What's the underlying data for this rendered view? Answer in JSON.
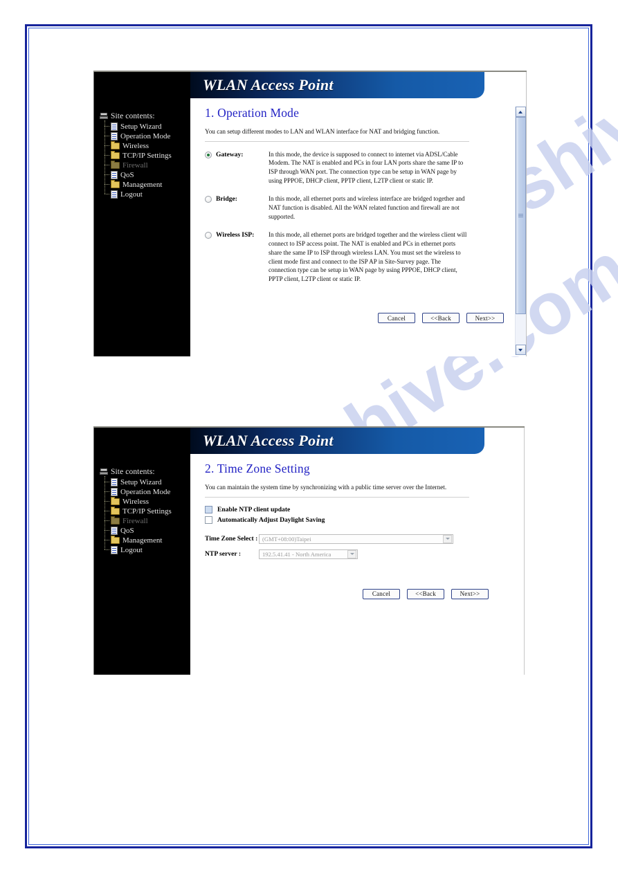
{
  "watermark": {
    "top_text": "manualshive.com",
    "bottom_text": "manualshive.com",
    "color": "#c9d2ef"
  },
  "theme": {
    "frame_border": "#16249b",
    "heading_color": "#2222c4",
    "titlebar_gradient_start": "#000b1e",
    "titlebar_gradient_end": "#1962b4",
    "sidebar_background": "#000000"
  },
  "sidebar": {
    "root": {
      "label": "Site contents:",
      "icon": "computer-icon"
    },
    "items": [
      {
        "label": "Setup Wizard",
        "icon": "page-icon",
        "dim": false
      },
      {
        "label": "Operation Mode",
        "icon": "page-icon",
        "dim": false
      },
      {
        "label": "Wireless",
        "icon": "folder-icon",
        "dim": false
      },
      {
        "label": "TCP/IP Settings",
        "icon": "folder-icon",
        "dim": false
      },
      {
        "label": "Firewall",
        "icon": "folder-icon",
        "dim": true
      },
      {
        "label": "QoS",
        "icon": "page-icon",
        "dim": false
      },
      {
        "label": "Management",
        "icon": "folder-icon",
        "dim": false
      },
      {
        "label": "Logout",
        "icon": "page-icon",
        "dim": false
      }
    ]
  },
  "panel1": {
    "titlebar": "WLAN Access Point",
    "heading": "1. Operation Mode",
    "intro": "You can setup different modes to LAN and WLAN interface for NAT and bridging function.",
    "modes": [
      {
        "name": "Gateway:",
        "selected": true,
        "description": "In this mode, the device is supposed to connect to internet via ADSL/Cable Modem. The NAT is enabled and PCs in four LAN ports share the same IP to ISP through WAN port. The connection type can be setup in WAN page by using PPPOE, DHCP client, PPTP client, L2TP client or static IP."
      },
      {
        "name": "Bridge:",
        "selected": false,
        "description": "In this mode, all ethernet ports and wireless interface are bridged together and NAT function is disabled. All the WAN related function and firewall are not supported."
      },
      {
        "name": "Wireless ISP:",
        "selected": false,
        "description": "In this mode, all ethernet ports are bridged together and the wireless client will connect to ISP access point. The NAT is enabled and PCs in ethernet ports share the same IP to ISP through wireless LAN. You must set the wireless to client mode first and connect to the ISP AP in Site-Survey page. The connection type can be setup in WAN page by using PPPOE, DHCP client, PPTP client, L2TP client or static IP."
      }
    ],
    "buttons": {
      "cancel": "Cancel",
      "back": "<<Back",
      "next": "Next>>"
    },
    "scrollbar": {
      "up_icon": "chevron-up-icon",
      "down_icon": "chevron-down-icon"
    }
  },
  "panel2": {
    "titlebar": "WLAN Access Point",
    "heading": "2. Time Zone Setting",
    "intro": "You can maintain the system time by synchronizing with a public time server over the Internet.",
    "checkboxes": [
      {
        "label": "Enable NTP client update",
        "checked": false,
        "tinted": true
      },
      {
        "label": "Automatically Adjust Daylight Saving",
        "checked": false,
        "tinted": false
      }
    ],
    "fields": [
      {
        "label": "Time Zone Select :",
        "value": "(GMT+08:00)Taipei"
      },
      {
        "label": "NTP server :",
        "value": "192.5.41.41 - North America"
      }
    ],
    "buttons": {
      "cancel": "Cancel",
      "back": "<<Back",
      "next": "Next>>"
    }
  }
}
